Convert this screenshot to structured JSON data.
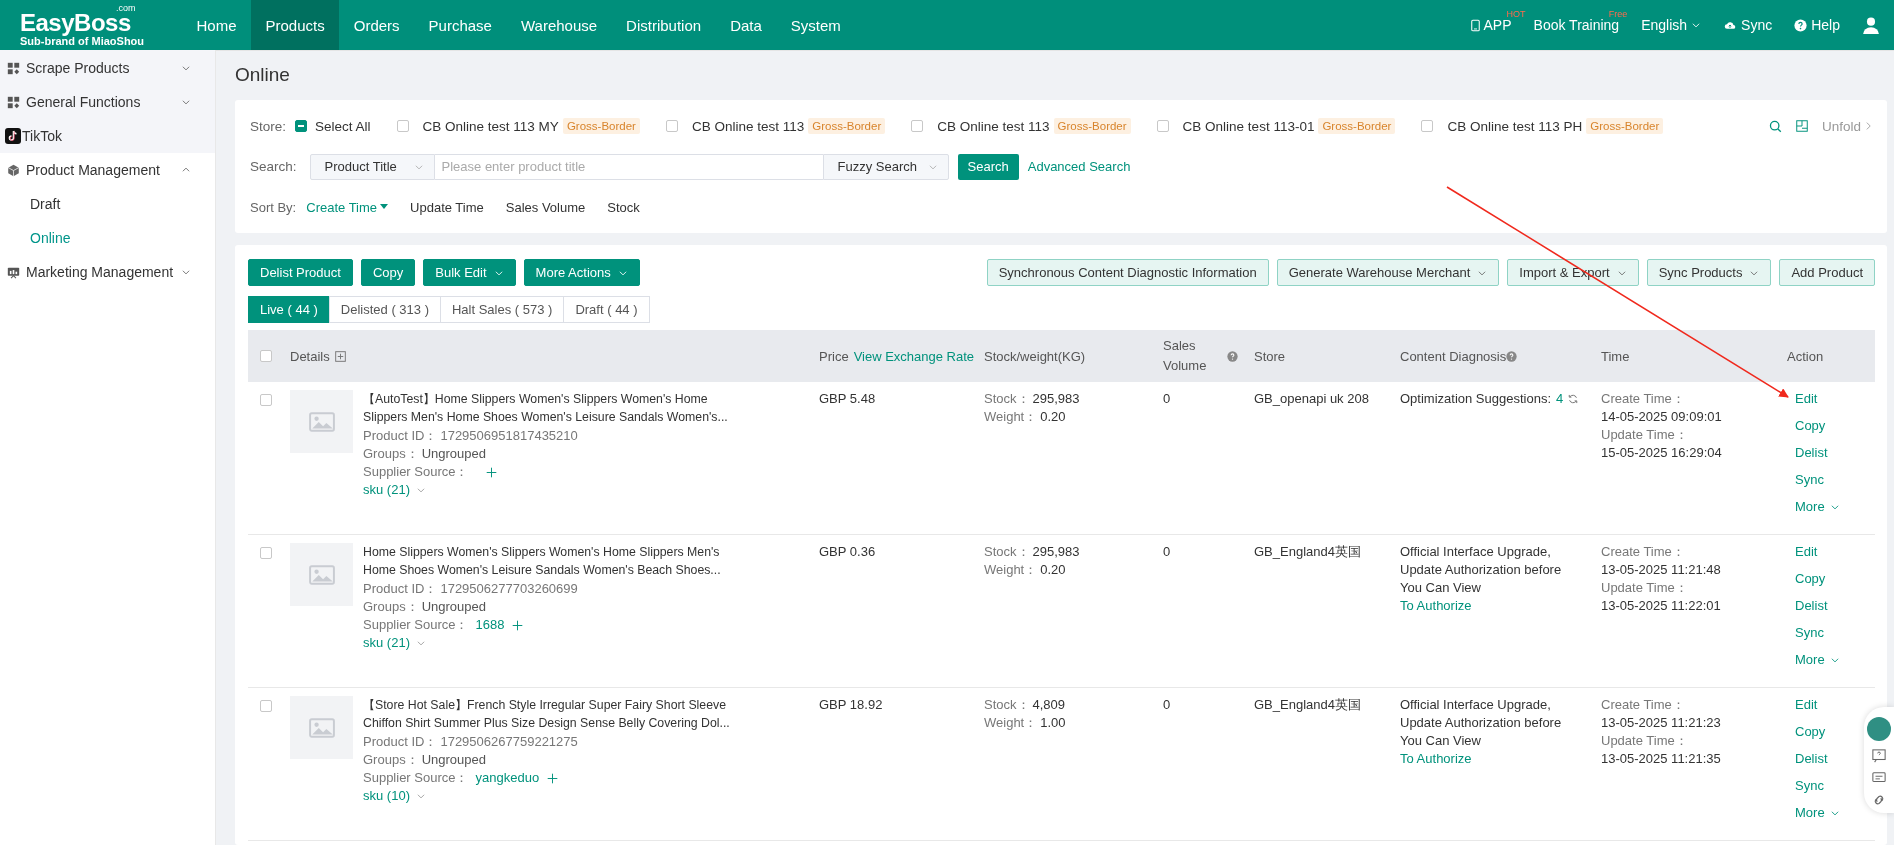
{
  "brand": {
    "name": "EasyBoss",
    "domain": ".com",
    "tagline": "Sub-brand of MiaoShou"
  },
  "nav": [
    {
      "label": "Home",
      "selected": false
    },
    {
      "label": "Products",
      "selected": true
    },
    {
      "label": "Orders",
      "selected": false
    },
    {
      "label": "Purchase",
      "selected": false
    },
    {
      "label": "Warehouse",
      "selected": false
    },
    {
      "label": "Distribution",
      "selected": false
    },
    {
      "label": "Data",
      "selected": false
    },
    {
      "label": "System",
      "selected": false
    }
  ],
  "top_right": {
    "app": "APP",
    "app_badge": "HOT",
    "training": "Book Training",
    "training_badge": "Free",
    "language": "English",
    "sync": "Sync",
    "help": "Help"
  },
  "sidebar": {
    "items": [
      {
        "label": "Scrape Products",
        "kind": "group",
        "expanded": false
      },
      {
        "label": "General Functions",
        "kind": "group",
        "expanded": false
      },
      {
        "label": "TikTok",
        "kind": "link"
      },
      {
        "label": "Product Management",
        "kind": "group",
        "expanded": true,
        "children": [
          {
            "label": "Draft",
            "selected": false
          },
          {
            "label": "Online",
            "selected": true
          }
        ]
      },
      {
        "label": "Marketing Management",
        "kind": "group",
        "expanded": false
      }
    ]
  },
  "page_title": "Online",
  "filters": {
    "store_label": "Store:",
    "select_all": {
      "label": "Select All",
      "indeterminate": true
    },
    "stores": [
      {
        "name": "CB Online test 113 MY",
        "tag": "Gross-Border",
        "checked": false
      },
      {
        "name": "CB Online test 113",
        "tag": "Gross-Border",
        "checked": false
      },
      {
        "name": "CB Online test 113",
        "tag": "Gross-Border",
        "checked": false
      },
      {
        "name": "CB Online test 113-01",
        "tag": "Gross-Border",
        "checked": false
      },
      {
        "name": "CB Online test 113 PH",
        "tag": "Gross-Border",
        "checked": false
      }
    ],
    "unfold": "Unfold",
    "search_label": "Search:",
    "field_select": "Product Title",
    "placeholder": "Please enter product title",
    "mode_select": "Fuzzy Search",
    "search_button": "Search",
    "advanced_search": "Advanced Search",
    "sort_label": "Sort By:",
    "sort_options": [
      {
        "label": "Create Time",
        "selected": true
      },
      {
        "label": "Update Time",
        "selected": false
      },
      {
        "label": "Sales Volume",
        "selected": false
      },
      {
        "label": "Stock",
        "selected": false
      }
    ]
  },
  "toolbar": {
    "left": [
      {
        "label": "Delist Product",
        "dropdown": false
      },
      {
        "label": "Copy",
        "dropdown": false
      },
      {
        "label": "Bulk Edit",
        "dropdown": true
      },
      {
        "label": "More Actions",
        "dropdown": true
      }
    ],
    "right": [
      {
        "label": "Synchronous Content Diagnostic Information",
        "dropdown": false
      },
      {
        "label": "Generate Warehouse Merchant",
        "dropdown": true
      },
      {
        "label": "Import & Export",
        "dropdown": true
      },
      {
        "label": "Sync Products",
        "dropdown": true
      },
      {
        "label": "Add Product",
        "dropdown": false
      }
    ]
  },
  "status_tabs": [
    {
      "label": "Live ( 44 )",
      "selected": true
    },
    {
      "label": "Delisted ( 313 )",
      "selected": false
    },
    {
      "label": "Halt Sales ( 573 )",
      "selected": false
    },
    {
      "label": "Draft ( 44 )",
      "selected": false
    }
  ],
  "table": {
    "all_checked": false,
    "columns": {
      "details": "Details",
      "price": "Price",
      "exchange_rate": "View Exchange Rate",
      "stock": "Stock/weight(KG)",
      "sales": "Sales Volume",
      "store": "Store",
      "diagnosis": "Content Diagnosis",
      "time": "Time",
      "action": "Action"
    },
    "rows": [
      {
        "checked": false,
        "title": "【AutoTest】Home Slippers Women's Slippers Women's Home Slippers Men's Home Shoes Women's Leisure Sandals Women's...",
        "product_id_label": "Product ID：",
        "product_id": "1729506951817435210",
        "groups_label": "Groups：",
        "groups": "Ungrouped",
        "supplier_label": "Supplier Source：",
        "sku": "sku (21)",
        "price": "GBP 5.48",
        "stock_label": "Stock：",
        "stock": "295,983",
        "weight_label": "Weight：",
        "weight": "0.20",
        "sales": "0",
        "store": "GB_openapi uk 208",
        "diagnosis": {
          "kind": "suggestion",
          "text": "Optimization Suggestions:",
          "count": "4"
        },
        "create_label": "Create Time：",
        "create_time": "14-05-2025 09:09:01",
        "update_label": "Update Time：",
        "update_time": "15-05-2025 16:29:04",
        "actions": [
          "Edit",
          "Copy",
          "Delist",
          "Sync",
          "More"
        ]
      },
      {
        "checked": false,
        "title": "Home Slippers Women's Slippers Women's Home Slippers Men's Home Shoes Women's Leisure Sandals Women's Beach Shoes...",
        "product_id_label": "Product ID：",
        "product_id": "1729506277703260699",
        "groups_label": "Groups：",
        "groups": "Ungrouped",
        "supplier_label": "Supplier Source：",
        "supplier": "1688",
        "sku": "sku (21)",
        "price": "GBP 0.36",
        "stock_label": "Stock：",
        "stock": "295,983",
        "weight_label": "Weight：",
        "weight": "0.20",
        "sales": "0",
        "store": "GB_England4英国",
        "diagnosis": {
          "kind": "authorize",
          "text": "Official Interface Upgrade, Update Authorization before You Can View",
          "link": "To Authorize"
        },
        "create_label": "Create Time：",
        "create_time": "13-05-2025 11:21:48",
        "update_label": "Update Time：",
        "update_time": "13-05-2025 11:22:01",
        "actions": [
          "Edit",
          "Copy",
          "Delist",
          "Sync",
          "More"
        ]
      },
      {
        "checked": false,
        "title": "【Store Hot Sale】French Style Irregular Super Fairy Short Sleeve Chiffon Shirt Summer Plus Size Design Sense Belly Covering Dol...",
        "product_id_label": "Product ID：",
        "product_id": "1729506267759221275",
        "groups_label": "Groups：",
        "groups": "Ungrouped",
        "supplier_label": "Supplier Source：",
        "supplier": "yangkeduo",
        "sku": "sku (10)",
        "price": "GBP 18.92",
        "stock_label": "Stock：",
        "stock": "4,809",
        "weight_label": "Weight：",
        "weight": "1.00",
        "sales": "0",
        "store": "GB_England4英国",
        "diagnosis": {
          "kind": "authorize",
          "text": "Official Interface Upgrade, Update Authorization before You Can View",
          "link": "To Authorize"
        },
        "create_label": "Create Time：",
        "create_time": "13-05-2025 11:21:23",
        "update_label": "Update Time：",
        "update_time": "13-05-2025 11:21:35",
        "actions": [
          "Edit",
          "Copy",
          "Delist",
          "Sync",
          "More"
        ]
      }
    ]
  }
}
